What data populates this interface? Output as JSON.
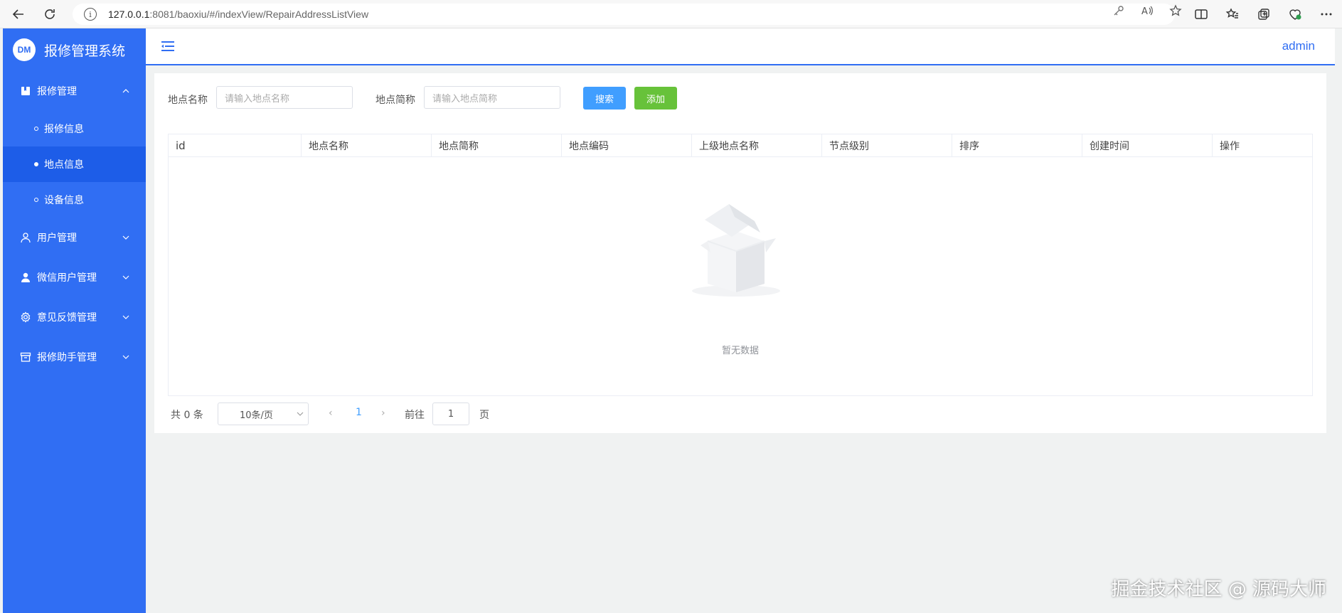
{
  "browser": {
    "url_host": "127.0.0.1",
    "url_rest": ":8081/baoxiu/#/indexView/RepairAddressListView"
  },
  "sidebar": {
    "logo_badge": "DM",
    "app_title": "报修管理系统",
    "groups": [
      {
        "label": "报修管理",
        "icon": "bookmark-book-icon",
        "expanded": true,
        "children": [
          {
            "label": "报修信息",
            "active": false
          },
          {
            "label": "地点信息",
            "active": true
          },
          {
            "label": "设备信息",
            "active": false
          }
        ]
      },
      {
        "label": "用户管理",
        "icon": "user-outline-icon",
        "expanded": false
      },
      {
        "label": "微信用户管理",
        "icon": "user-solid-icon",
        "expanded": false
      },
      {
        "label": "意见反馈管理",
        "icon": "gear-icon",
        "expanded": false
      },
      {
        "label": "报修助手管理",
        "icon": "box-icon",
        "expanded": false
      }
    ]
  },
  "header": {
    "user": "admin"
  },
  "filters": {
    "name_label": "地点名称",
    "name_placeholder": "请输入地点名称",
    "short_label": "地点简称",
    "short_placeholder": "请输入地点简称",
    "search_button": "搜索",
    "add_button": "添加"
  },
  "table": {
    "columns": [
      "id",
      "地点名称",
      "地点简称",
      "地点编码",
      "上级地点名称",
      "节点级别",
      "排序",
      "创建时间",
      "操作"
    ],
    "empty_text": "暂无数据"
  },
  "pagination": {
    "total_text": "共 0 条",
    "page_size": "10条/页",
    "current_page": "1",
    "goto_label": "前往",
    "goto_value": "1",
    "goto_suffix": "页"
  },
  "watermark": "掘金技术社区 @ 源码大师",
  "colors": {
    "sidebar": "#306ef3",
    "active_item": "#1d5de8",
    "primary": "#409eff",
    "success": "#67c23a"
  }
}
